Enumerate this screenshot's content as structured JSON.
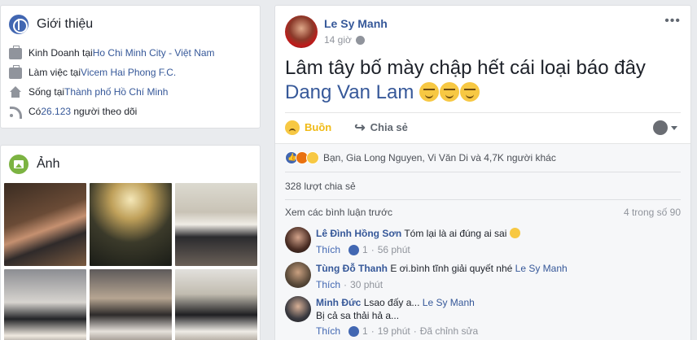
{
  "intro": {
    "title": "Giới thiệu",
    "rows": [
      {
        "icon": "briefcase-icon",
        "prefix": "Kinh Doanh tại ",
        "link": "Ho Chi Minh City - Việt Nam",
        "suffix": ""
      },
      {
        "icon": "briefcase-icon",
        "prefix": "Làm việc tại ",
        "link": "Vicem Hai Phong F.C.",
        "suffix": ""
      },
      {
        "icon": "house-icon",
        "prefix": "Sống tại ",
        "link": "Thành phố Hồ Chí Minh",
        "suffix": ""
      },
      {
        "icon": "rss-icon",
        "prefix": "Có ",
        "link": "26.123",
        "suffix": " người theo dõi"
      }
    ]
  },
  "photos": {
    "title": "Ảnh"
  },
  "post": {
    "author": "Le Sy Manh",
    "time": "14 giờ",
    "more": "•••",
    "text": "Lâm tây bố mày chập hết cái loại báo đây",
    "mention": "Dang Van Lam",
    "actions": {
      "reaction": "Buồn",
      "share": "Chia sẻ"
    },
    "reactions_text": "Bạn, Gia Long Nguyen, Vi Văn Di và 4,7K người khác",
    "shares_text": "328 lượt chia sẻ",
    "view_more": "Xem các bình luận trước",
    "comment_count": "4 trong số 90",
    "comments": [
      {
        "name": "Lê Đình Hồng Sơn",
        "text": "Tóm lại là ai đúng ai sai",
        "mention": "",
        "text2": "",
        "like_label": "Thích",
        "likes": "1",
        "time": "56 phút",
        "edited": ""
      },
      {
        "name": "Tùng Đỗ Thanh",
        "text": "E ơi.bình tĩnh giải quyết nhé",
        "mention": "Le Sy Manh",
        "text2": "",
        "like_label": "Thích",
        "likes": "",
        "time": "30 phút",
        "edited": ""
      },
      {
        "name": "Minh Đức",
        "text": "Lsao đấy a...",
        "mention": "Le Sy Manh",
        "text2": "Bị cả sa thải hả a...",
        "like_label": "Thích",
        "likes": "1",
        "time": "19 phút",
        "edited": "Đã chỉnh sửa"
      }
    ]
  },
  "colors": {
    "link": "#365899",
    "background": "#e9ebee",
    "sad": "#f0ba15"
  }
}
